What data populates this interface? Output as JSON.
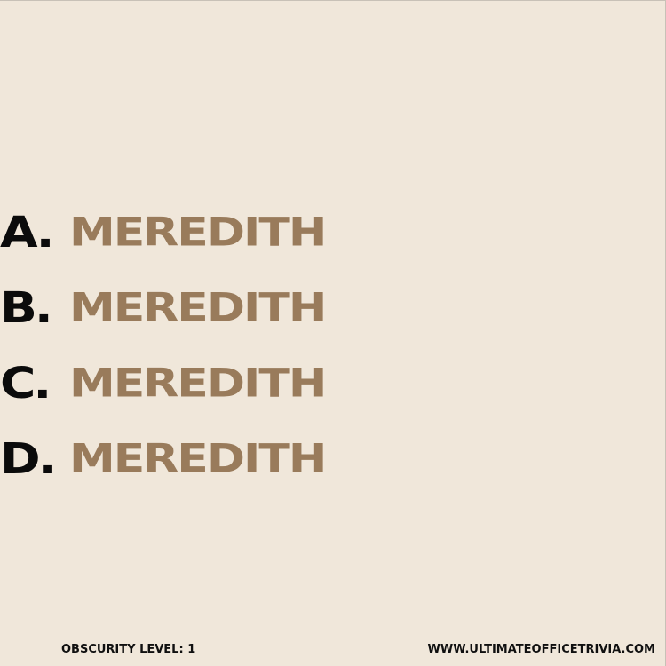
{
  "answers": [
    {
      "letter": "A.",
      "text": "MEREDITH"
    },
    {
      "letter": "B.",
      "text": "MEREDITH"
    },
    {
      "letter": "C.",
      "text": "MEREDITH"
    },
    {
      "letter": "D.",
      "text": "MEREDITH"
    }
  ],
  "footer": {
    "obscurity_level": "OBSCURITY LEVEL: 1",
    "website": "WWW.ULTIMATEOFFICETRIVIA.COM"
  },
  "colors": {
    "background": "#f0e7da",
    "letter": "#0b0b0b",
    "answer": "#997b5b",
    "footer_text": "#101010"
  }
}
